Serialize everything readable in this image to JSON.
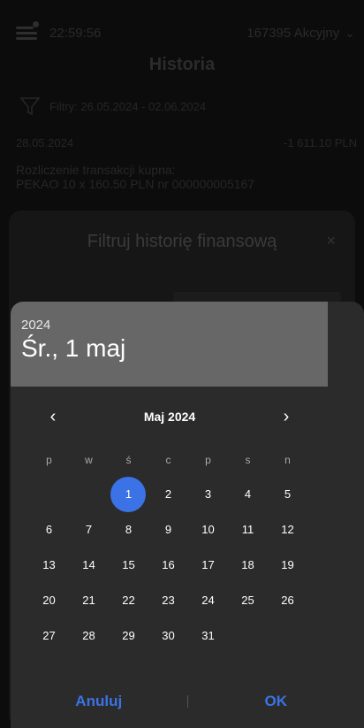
{
  "app": {
    "time": "22:59:56",
    "account": "167395 Akcyjny",
    "page_title": "Historia",
    "filters_label": "Filtry: 26.05.2024 - 02.06.2024",
    "transaction": {
      "date": "28.05.2024",
      "amount": "-1 611.10 PLN",
      "description_line1": "Rozliczenie transakcji kupna:",
      "description_line2": "PEKAO 10 x 160.50 PLN nr 000000005167"
    }
  },
  "filter_dialog": {
    "title": "Filtruj historię finansową",
    "close": "×"
  },
  "picker": {
    "year": "2024",
    "selected_date": "Śr., 1 maj",
    "month_label": "Maj 2024",
    "prev": "‹",
    "next": "›",
    "weekdays": [
      "p",
      "w",
      "ś",
      "c",
      "p",
      "s",
      "n"
    ],
    "weeks": [
      [
        "",
        "",
        "1",
        "2",
        "3",
        "4",
        "5"
      ],
      [
        "6",
        "7",
        "8",
        "9",
        "10",
        "11",
        "12"
      ],
      [
        "13",
        "14",
        "15",
        "16",
        "17",
        "18",
        "19"
      ],
      [
        "20",
        "21",
        "22",
        "23",
        "24",
        "25",
        "26"
      ],
      [
        "27",
        "28",
        "29",
        "30",
        "31",
        "",
        ""
      ]
    ],
    "selected_day": "1",
    "cancel": "Anuluj",
    "ok": "OK"
  },
  "colors": {
    "accent": "#3b73e6",
    "header_bg": "#676767",
    "picker_bg": "#2b2b2b"
  }
}
